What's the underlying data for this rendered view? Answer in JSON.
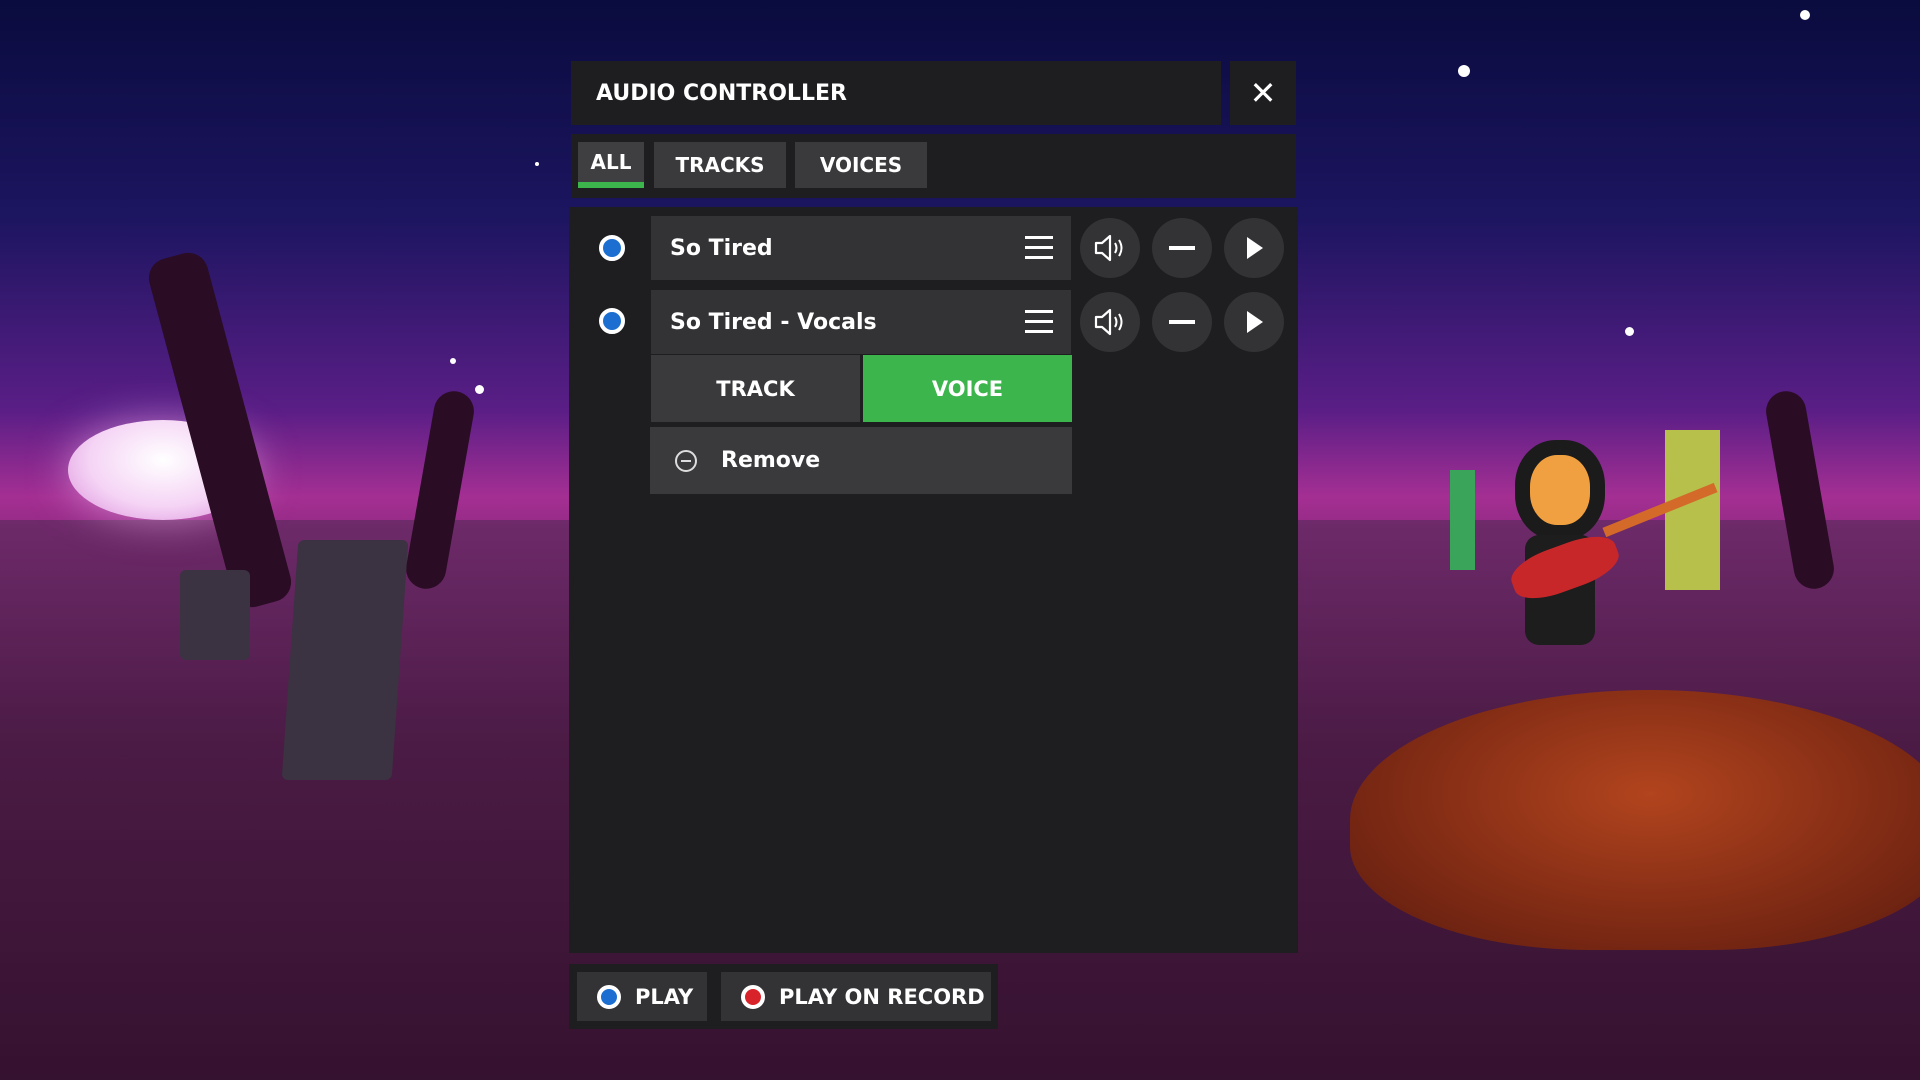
{
  "window": {
    "title": "AUDIO CONTROLLER",
    "close_glyph": "✕"
  },
  "tabs": [
    {
      "label": "ALL",
      "active": true
    },
    {
      "label": "TRACKS",
      "active": false
    },
    {
      "label": "VOICES",
      "active": false
    }
  ],
  "tracks": [
    {
      "name": "So Tired",
      "selected": true
    },
    {
      "name": "So Tired - Vocals",
      "selected": true
    }
  ],
  "expanded": {
    "type_options": [
      {
        "label": "TRACK",
        "active": false
      },
      {
        "label": "VOICE",
        "active": true
      }
    ],
    "remove_label": "Remove"
  },
  "bottom": {
    "play_label": "PLAY",
    "play_on_record_label": "PLAY ON RECORD"
  },
  "colors": {
    "accent_green": "#3cb54c",
    "radio_blue": "#1c6fd0",
    "record_red": "#d8232a"
  }
}
